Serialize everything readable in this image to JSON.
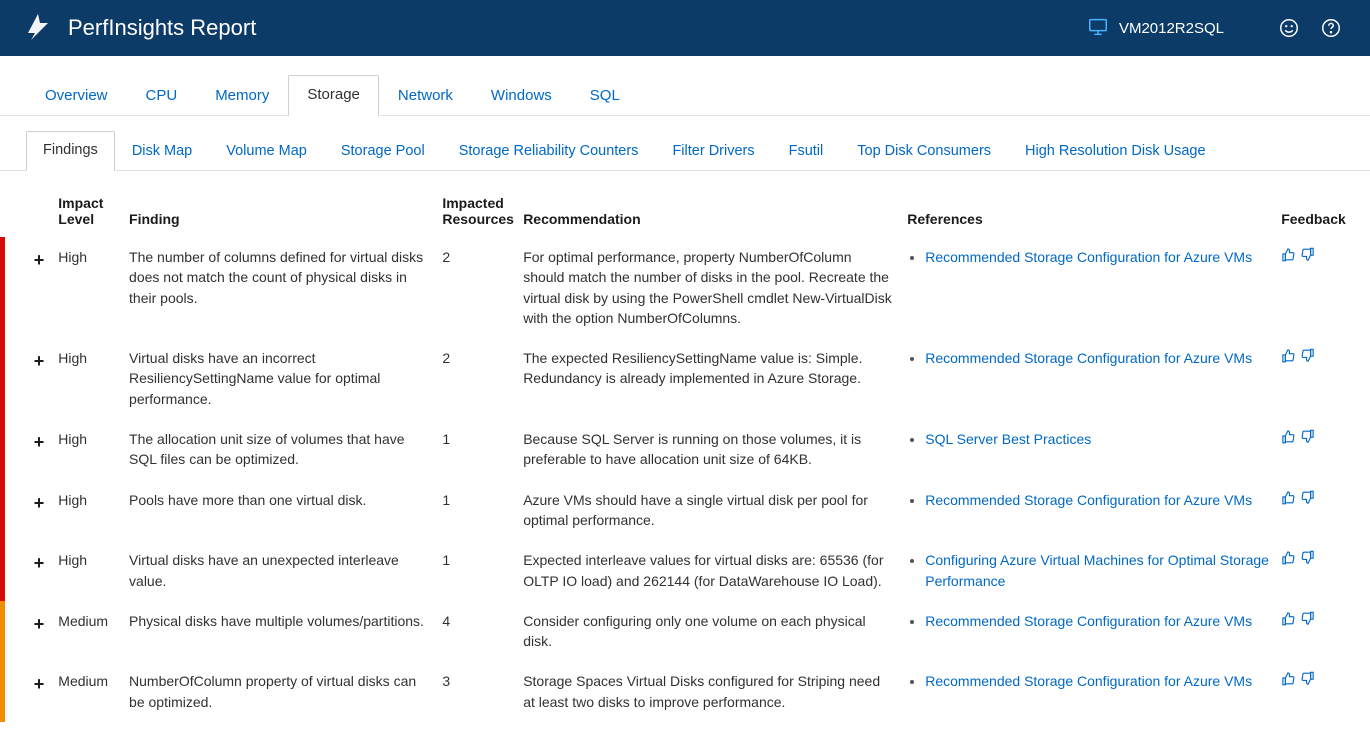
{
  "header": {
    "title": "PerfInsights Report",
    "vm_name": "VM2012R2SQL"
  },
  "tabs": [
    {
      "label": "Overview",
      "active": false
    },
    {
      "label": "CPU",
      "active": false
    },
    {
      "label": "Memory",
      "active": false
    },
    {
      "label": "Storage",
      "active": true
    },
    {
      "label": "Network",
      "active": false
    },
    {
      "label": "Windows",
      "active": false
    },
    {
      "label": "SQL",
      "active": false
    }
  ],
  "subtabs": [
    {
      "label": "Findings",
      "active": true
    },
    {
      "label": "Disk Map",
      "active": false
    },
    {
      "label": "Volume Map",
      "active": false
    },
    {
      "label": "Storage Pool",
      "active": false
    },
    {
      "label": "Storage Reliability Counters",
      "active": false
    },
    {
      "label": "Filter Drivers",
      "active": false
    },
    {
      "label": "Fsutil",
      "active": false
    },
    {
      "label": "Top Disk Consumers",
      "active": false
    },
    {
      "label": "High Resolution Disk Usage",
      "active": false
    }
  ],
  "columns": {
    "impact_level": "Impact Level",
    "finding": "Finding",
    "impacted_resources": "Impacted Resources",
    "recommendation": "Recommendation",
    "references": "References",
    "feedback": "Feedback"
  },
  "references_text": {
    "rec_storage": "Recommended Storage Configuration for Azure VMs",
    "sql_best": "SQL Server Best Practices",
    "conf_optimal": "Configuring Azure Virtual Machines for Optimal Storage Performance"
  },
  "rows": [
    {
      "impact": "High",
      "finding": "The number of columns defined for virtual disks does not match the count of physical disks in their pools.",
      "impacted": "2",
      "recommendation": "For optimal performance, property NumberOfColumn should match the number of disks in the pool. Recreate the virtual disk by using the PowerShell cmdlet New-VirtualDisk with the option NumberOfColumns.",
      "ref": "rec_storage"
    },
    {
      "impact": "High",
      "finding": "Virtual disks have an incorrect ResiliencySettingName value for optimal performance.",
      "impacted": "2",
      "recommendation": "The expected ResiliencySettingName value is: Simple. Redundancy is already implemented in Azure Storage.",
      "ref": "rec_storage"
    },
    {
      "impact": "High",
      "finding": "The allocation unit size of volumes that have SQL files can be optimized.",
      "impacted": "1",
      "recommendation": "Because SQL Server is running on those volumes, it is preferable to have allocation unit size of 64KB.",
      "ref": "sql_best"
    },
    {
      "impact": "High",
      "finding": "Pools have more than one virtual disk.",
      "impacted": "1",
      "recommendation": "Azure VMs should have a single virtual disk per pool for optimal performance.",
      "ref": "rec_storage"
    },
    {
      "impact": "High",
      "finding": "Virtual disks have an unexpected interleave value.",
      "impacted": "1",
      "recommendation": "Expected interleave values for virtual disks are: 65536 (for OLTP IO load) and 262144 (for DataWarehouse IO Load).",
      "ref": "conf_optimal"
    },
    {
      "impact": "Medium",
      "finding": "Physical disks have multiple volumes/partitions.",
      "impacted": "4",
      "recommendation": "Consider configuring only one volume on each physical disk.",
      "ref": "rec_storage"
    },
    {
      "impact": "Medium",
      "finding": "NumberOfColumn property of virtual disks can be optimized.",
      "impacted": "3",
      "recommendation": "Storage Spaces Virtual Disks configured for Striping need at least two disks to improve performance.",
      "ref": "rec_storage"
    }
  ]
}
